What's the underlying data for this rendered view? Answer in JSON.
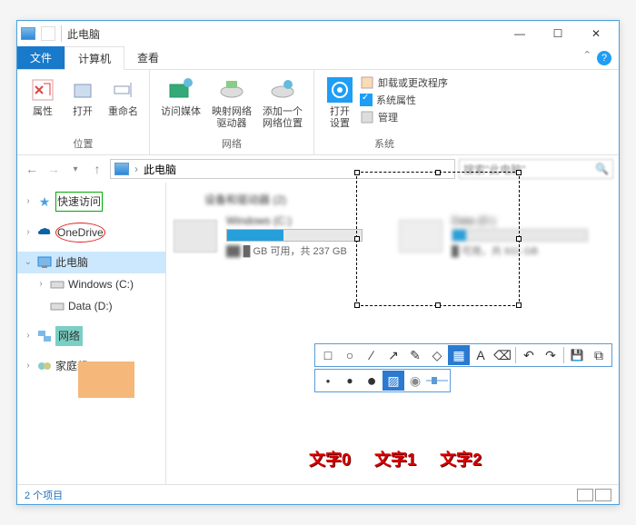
{
  "window": {
    "title": "此电脑",
    "controls": {
      "min": "—",
      "max": "☐",
      "close": "✕"
    }
  },
  "tabs": {
    "file": "文件",
    "computer": "计算机",
    "view": "查看",
    "expand": "ˆ",
    "help": "?"
  },
  "ribbon": {
    "group1": {
      "label": "位置",
      "properties": "属性",
      "open": "打开",
      "rename": "重命名"
    },
    "group2": {
      "label": "网络",
      "media": "访问媒体",
      "map_drive": "映射网络\n驱动器",
      "add_net": "添加一个\n网络位置"
    },
    "group3": {
      "label": "系统",
      "open_settings": "打开\n设置",
      "uninstall": "卸载或更改程序",
      "sysprops": "系统属性",
      "manage": "管理"
    }
  },
  "address": {
    "path": "此电脑",
    "search_placeholder": "搜索\"此电脑\""
  },
  "nav": {
    "quick_access": "快速访问",
    "onedrive": "OneDrive",
    "this_pc": "此电脑",
    "win_c": "Windows (C:)",
    "data_d": "Data (D:)",
    "network": "网络",
    "homegroup": "家庭组"
  },
  "content": {
    "group_header": "设备和驱动器 (2)",
    "drive1": {
      "name": "Windows (C:)",
      "sub_blur": "█ GB 可用，共 237 GB",
      "fill_pct": 42
    },
    "drive2": {
      "name": "Data (D:)",
      "sub_blur": "█ 可用，共 931 GB",
      "fill_pct": 10
    }
  },
  "status": {
    "count": "2 个项目"
  },
  "text_labels": [
    "文字0",
    "文字1",
    "文字2"
  ],
  "toolbar": {
    "tips": {
      "rect": "□",
      "ellipse": "○",
      "line": "∕",
      "arrow": "↗",
      "pencil": "✎",
      "marker": "◇",
      "mosaic": "▦",
      "text": "A",
      "eraser": "⌫",
      "undo": "↶",
      "redo": "↷",
      "save": "💾",
      "copy": "⧉",
      "close": "✕",
      "ok": "✓"
    },
    "dots": [
      "●",
      "●",
      "●"
    ],
    "hatch": "▨",
    "blur": "◉"
  }
}
